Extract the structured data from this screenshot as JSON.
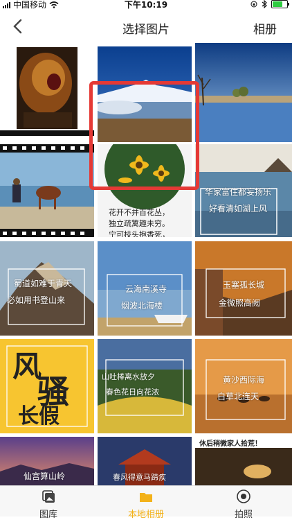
{
  "status": {
    "carrier": "中国移动",
    "time": "下午10:19"
  },
  "nav": {
    "title": "选择图片",
    "right_label": "相册"
  },
  "tiles": {
    "t6_line1": "华家富住都妄扬乐",
    "t6_line2": "好看清如湖上风",
    "t5_line1": "花开不并百花丛，",
    "t5_line2": "独立疏篱趣未穷。",
    "t5_line3": "宁可枝头抱香死，",
    "t7_line1": "蜀道如难于青天",
    "t7_line2": "必如用书登山来",
    "t8_line1": "云海南溪寺",
    "t8_line2": "烟波北海楼",
    "t9_line1": "玉塞孤长城",
    "t9_line2": "金微照高阙",
    "t10_big1": "风",
    "t10_big2": "骚",
    "t10_big3": "长假",
    "t11_line1": "山吐棒离水放夕",
    "t11_line2": "春色花日向花浓",
    "t12_line1": "黄沙西际海",
    "t12_line2": "白草北连天",
    "t13_line1": "仙宫算山岭",
    "t14_line1": "春风得意马蹄疾",
    "t15_line1": "休后稍微家人拾荒！"
  },
  "tabbar": {
    "tab1_label": "图库",
    "tab2_label": "本地相册",
    "tab3_label": "拍照"
  },
  "colors": {
    "accent": "#f3b21a",
    "selection": "#e53935"
  }
}
